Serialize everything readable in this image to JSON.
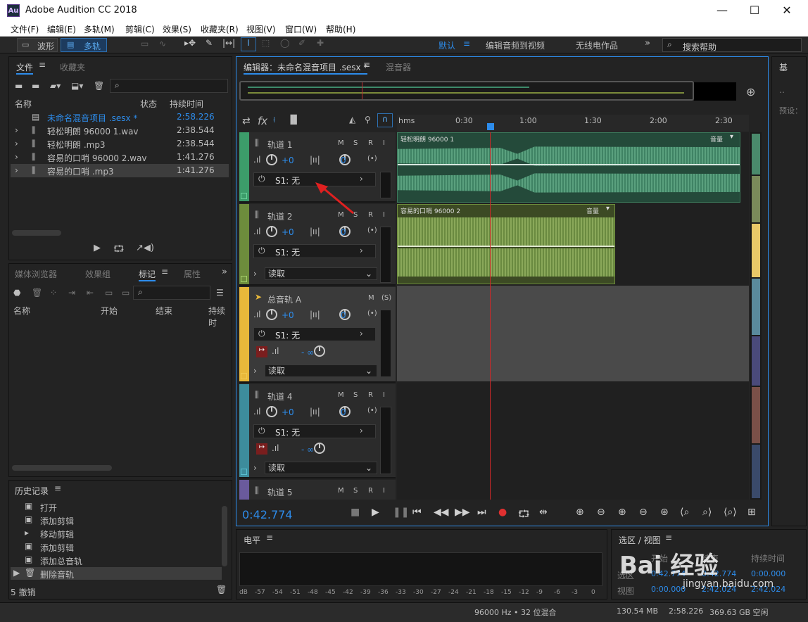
{
  "window": {
    "app_icon": "Au",
    "title": "Adobe Audition CC 2018",
    "minimize": "—",
    "maximize": "☐",
    "close": "✕"
  },
  "menu": [
    "文件(F)",
    "编辑(E)",
    "多轨(M)",
    "剪辑(C)",
    "效果(S)",
    "收藏夹(R)",
    "视图(V)",
    "窗口(W)",
    "帮助(H)"
  ],
  "toolbar": {
    "waveform": "波形",
    "multitrack": "多轨",
    "workspace_default": "默认",
    "workspace_video": "编辑音频到视频",
    "workspace_radio": "无线电作品",
    "search_placeholder": "搜索帮助"
  },
  "files_panel": {
    "tab_files": "文件",
    "tab_favorites": "收藏夹",
    "col_name": "名称",
    "col_status": "状态",
    "col_duration": "持续时间",
    "rows": [
      {
        "name": "未命名混音项目 .sesx *",
        "duration": "2:58.226"
      },
      {
        "name": "轻松明朗 96000 1.wav",
        "duration": "2:38.544"
      },
      {
        "name": "轻松明朗 .mp3",
        "duration": "2:38.544"
      },
      {
        "name": "容易的口哨 96000 2.wav",
        "duration": "1:41.276"
      },
      {
        "name": "容易的口哨 .mp3",
        "duration": "1:41.276"
      }
    ]
  },
  "markers_panel": {
    "tab_media": "媒体浏览器",
    "tab_effects": "效果组",
    "tab_markers": "标记",
    "tab_props": "属性",
    "col_name": "名称",
    "col_start": "开始",
    "col_end": "结束",
    "col_duration": "持续时"
  },
  "history_panel": {
    "title": "历史记录",
    "items": [
      "打开",
      "添加剪辑",
      "移动剪辑",
      "添加剪辑",
      "添加总音轨",
      "删除音轨"
    ],
    "undo": "5 撤销"
  },
  "editor": {
    "tab_editor": "编辑器：未命名混音项目 .sesx *",
    "tab_mixer": "混音器",
    "ruler": [
      "hms",
      "0:30",
      "1:00",
      "1:30",
      "2:00",
      "2:30"
    ],
    "time": "0:42.774",
    "tracks": [
      {
        "name": "轨道 1",
        "vol": "+0",
        "pan": "0",
        "fx": "S1: 无",
        "color": "#3c9c6a"
      },
      {
        "name": "轨道 2",
        "vol": "+0",
        "pan": "0",
        "fx": "S1: 无",
        "read": "读取",
        "color": "#6d8c3c"
      },
      {
        "name": "总音轨 A",
        "vol": "+0",
        "pan": "0",
        "fx": "S1: 无",
        "read": "读取",
        "send": "- ∞",
        "color": "#e8b83a"
      },
      {
        "name": "轨道 4",
        "vol": "+0",
        "pan": "0",
        "fx": "S1: 无",
        "read": "读取",
        "send": "- ∞",
        "color": "#3d8c9c"
      },
      {
        "name": "轨道 5",
        "color": "#6a5a9c"
      }
    ],
    "clips": [
      {
        "name": "轻松明朗 96000 1",
        "label": "音量"
      },
      {
        "name": "容易的口哨 96000 2",
        "label": "音量"
      }
    ]
  },
  "levels_panel": {
    "title": "电平",
    "scale": [
      "dB",
      "-57",
      "-54",
      "-51",
      "-48",
      "-45",
      "-42",
      "-39",
      "-36",
      "-33",
      "-30",
      "-27",
      "-24",
      "-21",
      "-18",
      "-15",
      "-12",
      "-9",
      "-6",
      "-3",
      "0"
    ]
  },
  "selection_panel": {
    "title": "选区 / 视图",
    "col_start": "开始",
    "col_end": "结束",
    "col_duration": "持续时间",
    "row_sel": "选区",
    "row_view": "视图",
    "sel_start": "0:42.774",
    "sel_end": "0:42.774",
    "sel_dur": "0:00.000",
    "view_start": "0:00.000",
    "view_end": "2:42.024",
    "view_dur": "2:42.024"
  },
  "right_panel": {
    "tab": "基",
    "label": "预设："
  },
  "status": {
    "format": "96000 Hz • 32 位混合",
    "size": "130.54 MB",
    "duration": "2:58.226",
    "free": "369.63 GB 空闲"
  },
  "watermark": {
    "text": "Bai 经验",
    "url": "jingyan.baidu.com"
  }
}
